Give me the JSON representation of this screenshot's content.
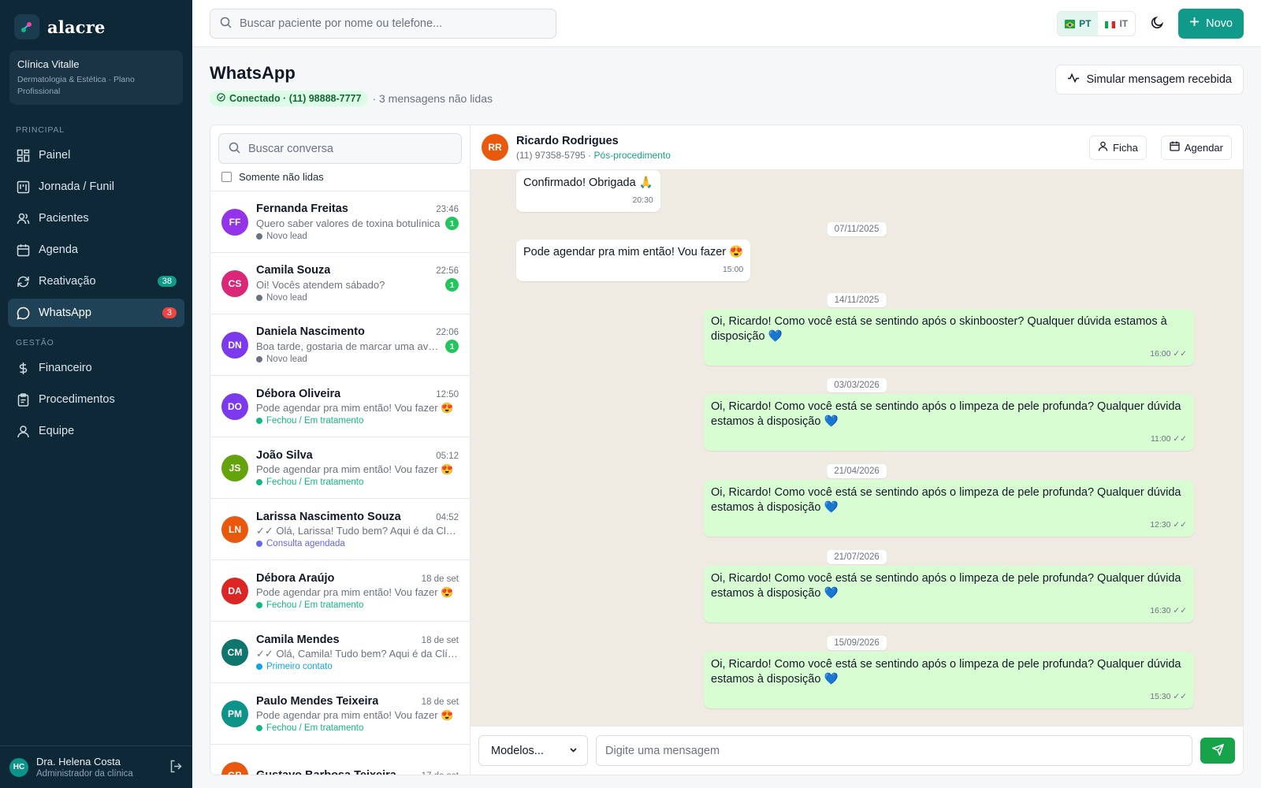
{
  "brand": {
    "name": "alacre"
  },
  "clinic": {
    "name": "Clínica Vitalle",
    "subtitle": "Dermatologia & Estética · Plano Profissional"
  },
  "nav": {
    "section_principal": "PRINCIPAL",
    "section_gestao": "GESTÃO",
    "items": [
      {
        "label": "Painel",
        "icon": "grid-icon"
      },
      {
        "label": "Jornada / Funil",
        "icon": "kanban-icon"
      },
      {
        "label": "Pacientes",
        "icon": "users-icon"
      },
      {
        "label": "Agenda",
        "icon": "calendar-icon"
      },
      {
        "label": "Reativação",
        "icon": "refresh-icon",
        "badge": "38"
      },
      {
        "label": "WhatsApp",
        "icon": "chat-icon",
        "badge": "3",
        "active": true
      },
      {
        "label": "Financeiro",
        "icon": "dollar-icon"
      },
      {
        "label": "Procedimentos",
        "icon": "clipboard-icon"
      },
      {
        "label": "Equipe",
        "icon": "user-icon"
      }
    ]
  },
  "user": {
    "initials": "HC",
    "name": "Dra. Helena Costa",
    "role": "Administrador da clínica"
  },
  "topbar": {
    "search_placeholder": "Buscar paciente por nome ou telefone...",
    "lang_pt": "PT",
    "lang_it": "IT",
    "new_label": "Novo"
  },
  "page": {
    "title": "WhatsApp",
    "connected_label": "Conectado · (11) 98888-7777",
    "unread_label": "· 3 mensagens não lidas",
    "simulate_label": "Simular mensagem recebida"
  },
  "conversations": {
    "search_placeholder": "Buscar conversa",
    "unread_only_label": "Somente não lidas",
    "items": [
      {
        "initials": "FF",
        "color": "#9333ea",
        "name": "Fernanda Freitas",
        "time": "23:46",
        "preview": "Quero saber valores de toxina botulínica",
        "unread": "1",
        "stage": "Novo lead",
        "stage_color": "#6b7280"
      },
      {
        "initials": "CS",
        "color": "#db2777",
        "name": "Camila Souza",
        "time": "22:56",
        "preview": "Oi! Vocês atendem sábado?",
        "unread": "1",
        "stage": "Novo lead",
        "stage_color": "#6b7280"
      },
      {
        "initials": "DN",
        "color": "#7c3aed",
        "name": "Daniela Nascimento",
        "time": "22:06",
        "preview": "Boa tarde, gostaria de marcar uma avaliação",
        "unread": "1",
        "stage": "Novo lead",
        "stage_color": "#6b7280"
      },
      {
        "initials": "DO",
        "color": "#7c3aed",
        "name": "Débora Oliveira",
        "time": "12:50",
        "preview": "Pode agendar pra mim então! Vou fazer 😍",
        "unread": "",
        "stage": "Fechou / Em tratamento",
        "stage_color": "#10b981"
      },
      {
        "initials": "JS",
        "color": "#65a30d",
        "name": "João Silva",
        "time": "05:12",
        "preview": "Pode agendar pra mim então! Vou fazer 😍",
        "unread": "",
        "stage": "Fechou / Em tratamento",
        "stage_color": "#10b981"
      },
      {
        "initials": "LN",
        "color": "#ea580c",
        "name": "Larissa Nascimento Souza",
        "time": "04:52",
        "preview": "✓✓ Olá, Larissa! Tudo bem? Aqui é da Clínica Vitalle",
        "unread": "",
        "stage": "Consulta agendada",
        "stage_color": "#6366f1"
      },
      {
        "initials": "DA",
        "color": "#dc2626",
        "name": "Débora Araújo",
        "time": "18 de set",
        "preview": "Pode agendar pra mim então! Vou fazer 😍",
        "unread": "",
        "stage": "Fechou / Em tratamento",
        "stage_color": "#10b981"
      },
      {
        "initials": "CM",
        "color": "#0f766e",
        "name": "Camila Mendes",
        "time": "18 de set",
        "preview": "✓✓ Olá, Camila! Tudo bem? Aqui é da Clínica Vitalle",
        "unread": "",
        "stage": "Primeiro contato",
        "stage_color": "#0ea5e9"
      },
      {
        "initials": "PM",
        "color": "#0d9488",
        "name": "Paulo Mendes Teixeira",
        "time": "18 de set",
        "preview": "Pode agendar pra mim então! Vou fazer 😍",
        "unread": "",
        "stage": "Fechou / Em tratamento",
        "stage_color": "#10b981"
      },
      {
        "initials": "GB",
        "color": "#ea580c",
        "name": "Gustavo Barbosa Teixeira",
        "time": "17 de set",
        "preview": "",
        "unread": "",
        "stage": "",
        "stage_color": "#6b7280"
      }
    ]
  },
  "chat": {
    "contact": {
      "initials": "RR",
      "color": "#ea580c",
      "name": "Ricardo Rodrigues",
      "phone": "(11) 97358-5795 ·",
      "stage": "Pós-procedimento"
    },
    "ficha_label": "Ficha",
    "agendar_label": "Agendar",
    "messages": [
      {
        "type": "in",
        "text": "Confirmado! Obrigada 🙏",
        "time": "20:30"
      },
      {
        "type": "date",
        "text": "07/11/2025"
      },
      {
        "type": "in",
        "text": "Pode agendar pra mim então! Vou fazer 😍",
        "time": "15:00"
      },
      {
        "type": "date",
        "text": "14/11/2025"
      },
      {
        "type": "out",
        "text": "Oi, Ricardo! Como você está se sentindo após o skinbooster? Qualquer dúvida estamos à disposição 💙",
        "time": "16:00 ✓✓"
      },
      {
        "type": "date",
        "text": "03/03/2026"
      },
      {
        "type": "out",
        "text": "Oi, Ricardo! Como você está se sentindo após o limpeza de pele profunda? Qualquer dúvida estamos à disposição 💙",
        "time": "11:00 ✓✓"
      },
      {
        "type": "date",
        "text": "21/04/2026"
      },
      {
        "type": "out",
        "text": "Oi, Ricardo! Como você está se sentindo após o limpeza de pele profunda? Qualquer dúvida estamos à disposição 💙",
        "time": "12:30 ✓✓"
      },
      {
        "type": "date",
        "text": "21/07/2026"
      },
      {
        "type": "out",
        "text": "Oi, Ricardo! Como você está se sentindo após o limpeza de pele profunda? Qualquer dúvida estamos à disposição 💙",
        "time": "16:30 ✓✓"
      },
      {
        "type": "date",
        "text": "15/09/2026"
      },
      {
        "type": "out",
        "text": "Oi, Ricardo! Como você está se sentindo após o limpeza de pele profunda? Qualquer dúvida estamos à disposição 💙",
        "time": "15:30 ✓✓"
      }
    ],
    "templates_label": "Modelos...",
    "input_placeholder": "Digite uma mensagem"
  },
  "colors": {
    "accent": "#0f9a8a",
    "sidebar": "#0f2838",
    "badge_red": "#ef4444",
    "badge_teal": "#0f9a8a",
    "bubble_out": "#d9fdd3"
  }
}
